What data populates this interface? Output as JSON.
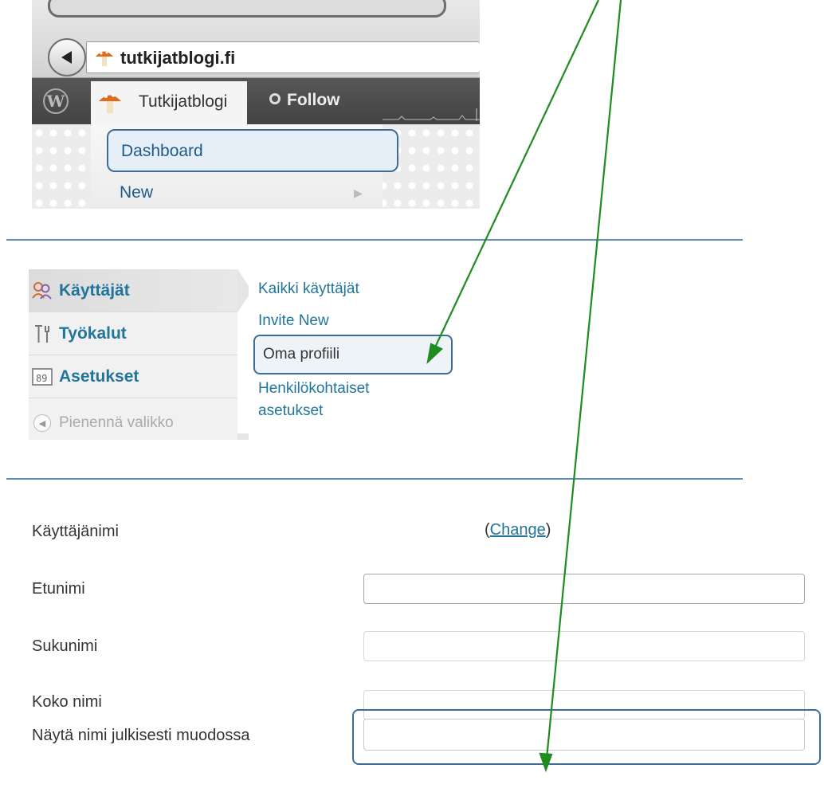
{
  "browser": {
    "url": "tutkijatblogi.fi"
  },
  "admin_bar": {
    "site_name": "Tutkijatblogi",
    "follow_label": "Follow"
  },
  "dropdown": {
    "items": [
      {
        "label": "Dashboard",
        "highlighted": true
      },
      {
        "label": "New",
        "has_submenu": true
      }
    ]
  },
  "side_menu": {
    "items": [
      {
        "label": "Käyttäjät",
        "icon": "users-icon",
        "active": true
      },
      {
        "label": "Työkalut",
        "icon": "tools-icon"
      },
      {
        "label": "Asetukset",
        "icon": "settings-icon"
      },
      {
        "label": "Pienennä valikko",
        "icon": "collapse-icon"
      }
    ],
    "submenu": [
      {
        "label": "Kaikki käyttäjät"
      },
      {
        "label": "Invite New"
      },
      {
        "label": "Oma profiili",
        "highlighted": true
      },
      {
        "label": "Henkilökohtaiset asetukset"
      }
    ]
  },
  "profile_form": {
    "username_label": "Käyttäjänimi",
    "change_link": "Change",
    "firstname_label": "Etunimi",
    "firstname_value": "",
    "lastname_label": "Sukunimi",
    "lastname_value": "",
    "fullname_label": "Koko nimi",
    "fullname_value": "",
    "display_name_label": "Näytä nimi julkisesti muodossa",
    "display_name_value": ""
  },
  "colors": {
    "link": "#21759b",
    "highlight_border": "#3f6c96",
    "divider": "#5f8fb0",
    "arrow": "#1e8c1e",
    "admin_bar": "#464646"
  }
}
